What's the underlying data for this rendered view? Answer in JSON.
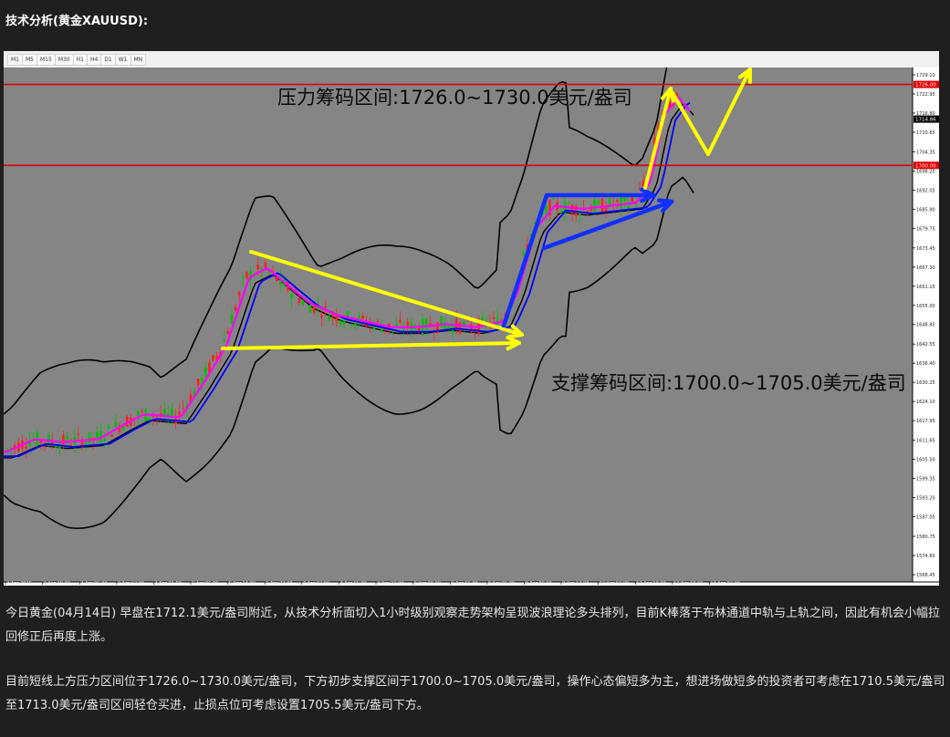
{
  "heading": "技术分析(黄金XAUUSD):",
  "timeframes": [
    "M1",
    "M5",
    "M15",
    "M30",
    "H1",
    "H4",
    "D1",
    "W1",
    "MN"
  ],
  "annotations": {
    "resistance": "压力筹码区间:1726.0~1730.0美元/盎司",
    "support": "支撑筹码区间:1700.0~1705.0美元/盎司"
  },
  "price_axis": [
    "1729.10",
    "1722.95",
    "1716.80",
    "1710.65",
    "1704.35",
    "1698.20",
    "1692.05",
    "1685.90",
    "1679.75",
    "1673.45",
    "1667.30",
    "1661.15",
    "1655.00",
    "1648.85",
    "1642.55",
    "1636.40",
    "1630.25",
    "1624.10",
    "1617.95",
    "1611.65",
    "1605.50",
    "1599.35",
    "1593.20",
    "1587.05",
    "1580.75",
    "1574.60",
    "1568.45"
  ],
  "price_tags": {
    "upper": "1726.00",
    "current": "1714.86",
    "lower": "1700.00"
  },
  "time_axis": [
    "2 Apr 2020",
    "2 Apr 20:00",
    "3 Apr 05:00",
    "3 Apr 13:00",
    "3 Apr 21:00",
    "6 Apr 06:00",
    "6 Apr 14:00",
    "6 Apr 22:00",
    "7 Apr 07:00",
    "7 Apr 15:00",
    "7 Apr 23:00",
    "8 Apr 08:00",
    "8 Apr 16:00",
    "9 Apr 01:00",
    "9 Apr 09:00",
    "9 Apr 17:00",
    "13 Apr 02:00",
    "13 Apr 10:00",
    "13 Apr 18:00",
    "14 Apr 03:00"
  ],
  "colors": {
    "resistance_line": "#e00000",
    "support_line": "#e00000",
    "arrow_yellow": "#ffff00",
    "arrow_blue": "#1030ff",
    "candle_up": "#00c000",
    "candle_down": "#ff2020",
    "band": "#000000",
    "ma_fast": "#ff00ff",
    "ma_slow": "#0000ff",
    "bg": "#858585"
  },
  "paragraphs": [
    "今日黄金(04月14日) 早盘在1712.1美元/盎司附近，从技术分析面切入1小时级别观察走势架构呈现波浪理论多头排列，目前K棒落于布林通道中轨与上轨之间，因此有机会小幅拉回修正后再度上涨。",
    "目前短线上方压力区间位于1726.0~1730.0美元/盎司，下方初步支撑区间于1700.0~1705.0美元/盎司，操作心态偏短多为主，想进场做短多的投资者可考虑在1710.5美元/盎司至1713.0美元/盎司区间轻仓买进，止损点位可考虑设置1705.5美元/盎司下方。"
  ]
}
